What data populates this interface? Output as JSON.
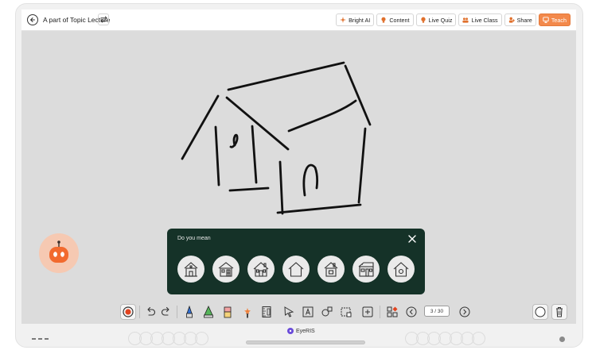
{
  "header": {
    "title": "A part of Topic Lecture",
    "nav": [
      {
        "label": "Bright AI",
        "icon": "sparkle-icon"
      },
      {
        "label": "Content",
        "icon": "content-icon"
      },
      {
        "label": "Live Quiz",
        "icon": "bulb-icon"
      },
      {
        "label": "Live Class",
        "icon": "class-icon"
      },
      {
        "label": "Share",
        "icon": "share-icon"
      },
      {
        "label": "Teach",
        "icon": "teach-icon"
      }
    ]
  },
  "suggestion": {
    "title": "Do you mean",
    "options": [
      "house-1",
      "house-2",
      "house-3",
      "house-4",
      "house-5",
      "house-6",
      "house-7"
    ]
  },
  "toolbar": {
    "page": "3 / 30"
  },
  "device": {
    "brand": "EyeRIS"
  },
  "colors": {
    "accent": "#f3894b",
    "panel": "#153228",
    "canvas": "#dcdcdc"
  }
}
